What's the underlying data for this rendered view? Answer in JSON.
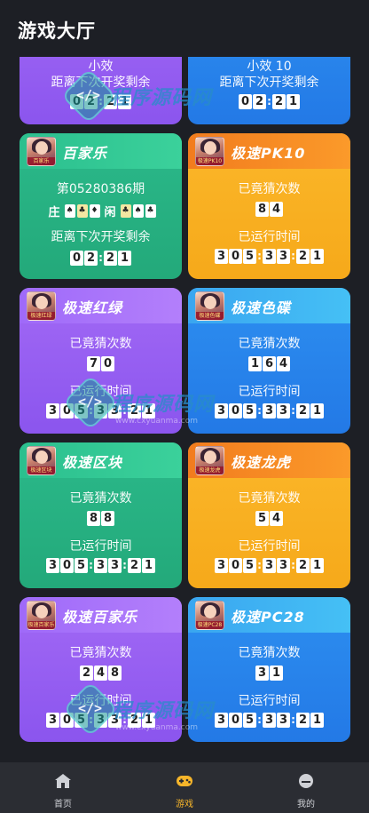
{
  "header": {
    "title": "游戏大厅"
  },
  "cards": [
    {
      "name": "小效",
      "top_line": "小效",
      "line2": "距离下次开奖剩余",
      "digits_a": [
        "0",
        "2",
        "2",
        "1"
      ]
    },
    {
      "name": "小效10",
      "top_line": "小效 10",
      "line2": "距离下次开奖剩余",
      "digits_a": [
        "0",
        "2",
        "2",
        "1"
      ]
    },
    {
      "name": "百家乐",
      "thumb_caption": "百家乐",
      "line1": "第05280386期",
      "banker": "庄",
      "player": "闲",
      "line2": "距离下次开奖剩余",
      "digits_a": [
        "0",
        "2",
        "2",
        "1"
      ]
    },
    {
      "name": "极速PK10",
      "thumb_caption": "极速PK10",
      "line1": "已竟猜次数",
      "count": [
        "8",
        "4"
      ],
      "line2": "已运行时间",
      "time": [
        "3",
        "0",
        "5",
        "3",
        "3",
        "2",
        "1"
      ]
    },
    {
      "name": "极速红绿",
      "thumb_caption": "极速红绿",
      "line1": "已竟猜次数",
      "count": [
        "7",
        "0"
      ],
      "line2": "已运行时间",
      "time": [
        "3",
        "0",
        "5",
        "3",
        "3",
        "2",
        "1"
      ]
    },
    {
      "name": "极速色碟",
      "thumb_caption": "极速色碟",
      "line1": "已竟猜次数",
      "count": [
        "1",
        "6",
        "4"
      ],
      "line2": "已运行时间",
      "time": [
        "3",
        "0",
        "5",
        "3",
        "3",
        "2",
        "1"
      ]
    },
    {
      "name": "极速区块",
      "thumb_caption": "极速区块",
      "line1": "已竟猜次数",
      "count": [
        "8",
        "8"
      ],
      "line2": "已运行时间",
      "time": [
        "3",
        "0",
        "5",
        "3",
        "3",
        "2",
        "1"
      ]
    },
    {
      "name": "极速龙虎",
      "thumb_caption": "极速龙虎",
      "line1": "已竟猜次数",
      "count": [
        "5",
        "4"
      ],
      "line2": "已运行时间",
      "time": [
        "3",
        "0",
        "5",
        "3",
        "3",
        "2",
        "1"
      ]
    },
    {
      "name": "极速百家乐",
      "thumb_caption": "极速百家乐",
      "line1": "已竟猜次数",
      "count": [
        "2",
        "4",
        "8"
      ],
      "line2": "已运行时间",
      "time": [
        "3",
        "0",
        "5",
        "3",
        "3",
        "2",
        "1"
      ]
    },
    {
      "name": "极速PC28",
      "thumb_caption": "极速PC28",
      "line1": "已竟猜次数",
      "count": [
        "3",
        "1"
      ],
      "line2": "已运行时间",
      "time": [
        "3",
        "0",
        "5",
        "3",
        "3",
        "2",
        "1"
      ]
    }
  ],
  "watermark": {
    "code": "</>",
    "text": "程序源码网",
    "url": "www.cxyuanma.com"
  },
  "tabbar": {
    "items": [
      {
        "label": "首页",
        "icon": "home-icon"
      },
      {
        "label": "游戏",
        "icon": "gamepad-icon",
        "active": true
      },
      {
        "label": "我的",
        "icon": "profile-icon"
      }
    ],
    "active_color": "#f6b52a"
  },
  "colors": {
    "purple": "#9a62f3",
    "blue": "#2a86ee",
    "green": "#27b283",
    "orange": "#f8ae20",
    "background": "#1d1f25"
  }
}
